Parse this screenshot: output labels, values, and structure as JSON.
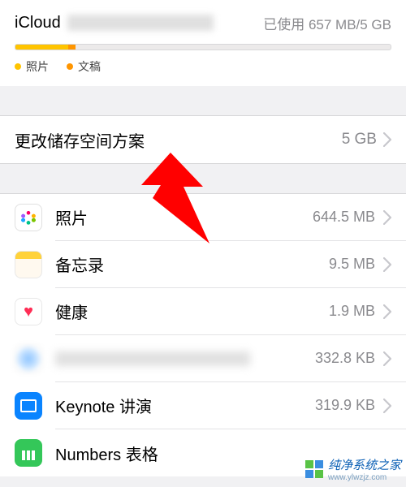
{
  "storage": {
    "account_label": "iCloud",
    "usage_text": "已使用 657 MB/5 GB",
    "legend": {
      "photos": "照片",
      "docs": "文稿"
    }
  },
  "plan": {
    "label": "更改储存空间方案",
    "value": "5 GB"
  },
  "apps": [
    {
      "name": "照片",
      "size": "644.5 MB",
      "icon": "photos-icon"
    },
    {
      "name": "备忘录",
      "size": "9.5 MB",
      "icon": "notes-icon"
    },
    {
      "name": "健康",
      "size": "1.9 MB",
      "icon": "health-icon"
    },
    {
      "name": "",
      "size": "332.8 KB",
      "icon": "blurred-icon",
      "masked": true
    },
    {
      "name": "Keynote 讲演",
      "size": "319.9 KB",
      "icon": "keynote-icon"
    },
    {
      "name": "Numbers 表格",
      "size": "",
      "icon": "numbers-icon"
    }
  ],
  "watermark": {
    "text": "纯净系统之家",
    "sub": "www.ylwzjz.com"
  },
  "colors": {
    "accent_yellow": "#ffc400",
    "accent_orange": "#ff9500",
    "arrow": "#ff0000"
  }
}
